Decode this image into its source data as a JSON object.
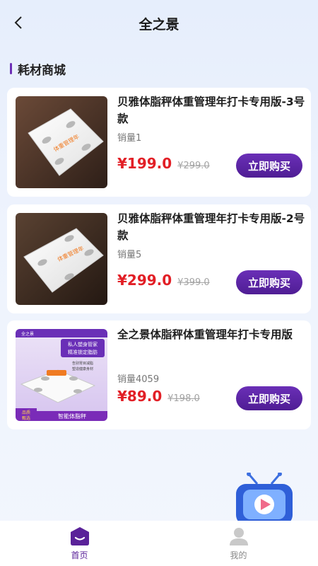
{
  "header": {
    "title": "全之景"
  },
  "section": {
    "title": "耗材商城"
  },
  "products": [
    {
      "name": "贝雅体脂秤体重管理年打卡专用版-3号款",
      "sales": "销量1",
      "price": "¥199.0",
      "original_price": "¥299.0",
      "buy_label": "立即购买",
      "scale_label": "体重管理年"
    },
    {
      "name": "贝雅体脂秤体重管理年打卡专用版-2号款",
      "sales": "销量5",
      "price": "¥299.0",
      "original_price": "¥399.0",
      "buy_label": "立即购买",
      "scale_label": "体重管理年"
    },
    {
      "name": "全之景体脂秤体重管理年打卡专用版",
      "sales": "销量4059",
      "price": "¥89.0",
      "original_price": "¥198.0",
      "buy_label": "立即购买",
      "promo": {
        "headline1": "私人塑身管家",
        "headline2": "精准锁定脂肪",
        "sub1": "告别胃目减脂",
        "sub2": "塑造健康身材",
        "badge_line1": "品质",
        "badge_line2": "甄选",
        "footer": "智能体脂秤",
        "brand": "全之景"
      }
    }
  ],
  "tabbar": {
    "home_label": "首页",
    "mine_label": "我的"
  },
  "colors": {
    "accent": "#5a2299",
    "price": "#e21f26"
  }
}
